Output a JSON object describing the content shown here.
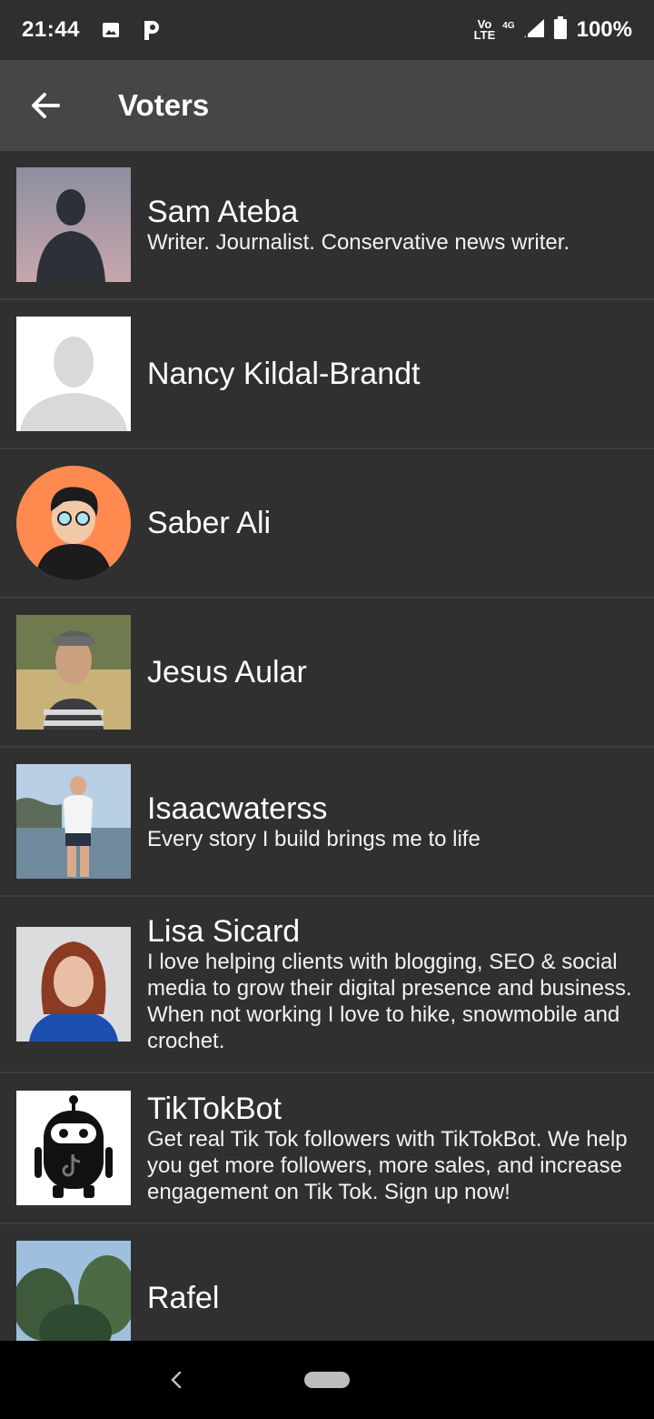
{
  "status_bar": {
    "time": "21:44",
    "volte_top": "Vo",
    "volte_bottom": "LTE",
    "network": "4G",
    "battery": "100%",
    "icons": [
      "image-icon",
      "p-app-icon",
      "signal-icon",
      "battery-icon"
    ]
  },
  "app_bar": {
    "title": "Voters",
    "back_icon": "arrow-left-icon"
  },
  "voters": [
    {
      "name": "Sam Ateba",
      "bio": "Writer. Journalist. Conservative news writer."
    },
    {
      "name": "Nancy Kildal-Brandt",
      "bio": ""
    },
    {
      "name": "Saber Ali",
      "bio": ""
    },
    {
      "name": "Jesus Aular",
      "bio": ""
    },
    {
      "name": "Isaacwaterss",
      "bio": "Every story I build brings me to life"
    },
    {
      "name": "Lisa Sicard",
      "bio": "I love helping clients with blogging, SEO & social media to grow their digital presence and business. When not working I love to hike, snowmobile and crochet."
    },
    {
      "name": "TikTokBot",
      "bio": "Get real Tik Tok followers with TikTokBot. We help you get more followers, more sales, and increase engagement on Tik Tok. Sign up now!"
    },
    {
      "name": "Rafel",
      "bio": ""
    }
  ],
  "colors": {
    "status_bar": "#2f2f2f",
    "app_bar": "#464646",
    "list_bg": "#303030",
    "divider": "#3c3c3c"
  }
}
